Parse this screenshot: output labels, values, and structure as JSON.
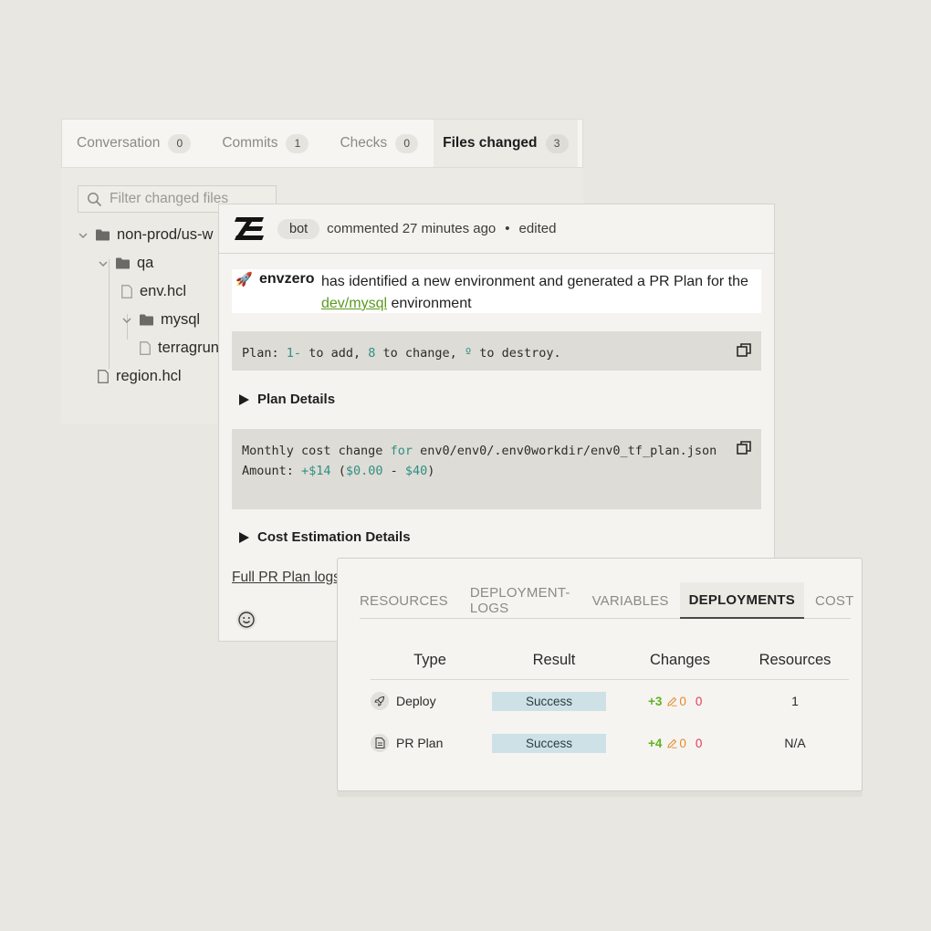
{
  "pr_tabs": [
    {
      "label": "Conversation",
      "count": "0"
    },
    {
      "label": "Commits",
      "count": "1"
    },
    {
      "label": "Checks",
      "count": "0"
    },
    {
      "label": "Files changed",
      "count": "3"
    }
  ],
  "file_filter": {
    "placeholder": "Filter changed files"
  },
  "file_tree": {
    "root_folder": "non-prod/us-w",
    "qa_folder": "qa",
    "env_file": "env.hcl",
    "mysql_folder": "mysql",
    "terragrunt_file": "terragrun",
    "region_file": "region.hcl"
  },
  "comment": {
    "author_badge": "bot",
    "meta": "commented 27 minutes ago",
    "edited": "edited",
    "mention_user": "envzero",
    "message_prefix": "has identified a new environment and generated a PR Plan for the",
    "env_link": "dev/mysql",
    "message_suffix": "environment",
    "plan": {
      "label": "Plan:",
      "add_count": "1-",
      "add_text": "to add,",
      "change_count": "8",
      "change_text": "to change,",
      "destroy_count": "º",
      "destroy_text": "to destroy."
    },
    "plan_details": "Plan Details",
    "cost": {
      "line1_prefix": "Monthly cost change",
      "line1_for": "for",
      "line1_path": "env0/env0/.env0workdir/env0_tf_plan.json",
      "line2_label": "Amount:",
      "amount": "+$14",
      "range_open": "(",
      "range_low": "$0.00",
      "range_sep": "-",
      "range_high": "$40",
      "range_close": ")"
    },
    "cost_details": "Cost Estimation Details",
    "full_logs": "Full PR Plan logs"
  },
  "deploy_tabs": [
    "RESOURCES",
    "DEPLOYMENT-LOGS",
    "VARIABLES",
    "DEPLOYMENTS",
    "COST"
  ],
  "deploy_table": {
    "columns": [
      "Type",
      "Result",
      "Changes",
      "Resources"
    ],
    "rows": [
      {
        "type": "Deploy",
        "icon": "rocket-icon",
        "result": "Success",
        "add": "+3",
        "edit": "0",
        "del": "0",
        "resources": "1"
      },
      {
        "type": "PR Plan",
        "icon": "document-icon",
        "result": "Success",
        "add": "+4",
        "edit": "0",
        "del": "0",
        "resources": "N/A"
      }
    ]
  },
  "colors": {
    "background": "#e8e7e1",
    "link_green": "#5a9a1e",
    "code_teal": "#2f8f84",
    "success_badge": "#cde1e6",
    "add_green": "#62b21f",
    "edit_orange": "#e58a2c",
    "delete_red": "#e23a55"
  }
}
